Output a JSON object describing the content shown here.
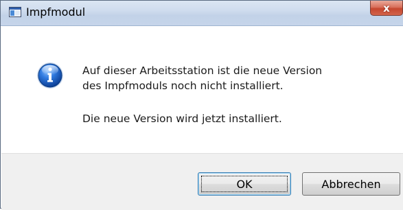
{
  "window": {
    "title": "Impfmodul",
    "close_glyph": "x"
  },
  "message": {
    "line1": "Auf dieser Arbeitsstation ist die neue Version",
    "line2": "des Impfmoduls noch nicht installiert.",
    "line3": "Die neue Version wird jetzt installiert."
  },
  "buttons": {
    "ok_label": "OK",
    "cancel_label": "Abbrechen"
  },
  "icons": {
    "app": "app-window-icon",
    "message": "information-icon",
    "close": "close-icon"
  },
  "colors": {
    "titlebar": "#c6d5ea",
    "close_button": "#c6472f",
    "info_icon": "#1e5fb8",
    "footer": "#f0f0f0"
  }
}
